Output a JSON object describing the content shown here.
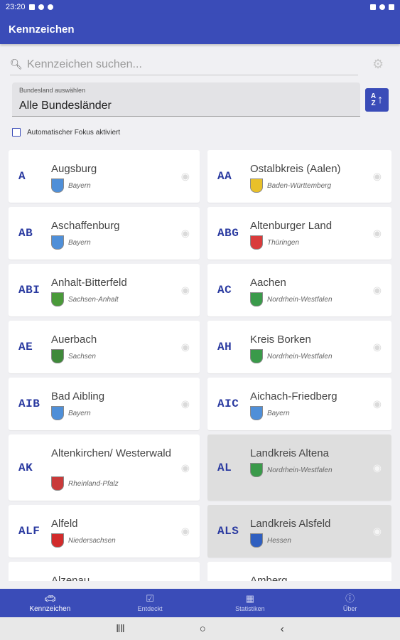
{
  "status": {
    "time": "23:20"
  },
  "appbar": {
    "title": "Kennzeichen"
  },
  "search": {
    "placeholder": "Kennzeichen suchen..."
  },
  "state_select": {
    "label": "Bundesland auswählen",
    "value": "Alle Bundesländer"
  },
  "sort_button": {
    "a": "A",
    "z": "Z"
  },
  "focus": {
    "label": "Automatischer Fokus aktiviert"
  },
  "plates": [
    {
      "code": "A",
      "name": "Augsburg",
      "state": "Bayern",
      "crest": "#4f8fd8"
    },
    {
      "code": "AA",
      "name": "Ostalbkreis (Aalen)",
      "state": "Baden-Württemberg",
      "crest": "#e8c02a"
    },
    {
      "code": "AB",
      "name": "Aschaffenburg",
      "state": "Bayern",
      "crest": "#4f8fd8"
    },
    {
      "code": "ABG",
      "name": "Altenburger Land",
      "state": "Thüringen",
      "crest": "#d93b3b"
    },
    {
      "code": "ABI",
      "name": "Anhalt-Bitterfeld",
      "state": "Sachsen-Anhalt",
      "crest": "#4a9a3a"
    },
    {
      "code": "AC",
      "name": "Aachen",
      "state": "Nordrhein-Westfalen",
      "crest": "#3a9a4a"
    },
    {
      "code": "AE",
      "name": "Auerbach",
      "state": "Sachsen",
      "crest": "#3f8a3a"
    },
    {
      "code": "AH",
      "name": "Kreis Borken",
      "state": "Nordrhein-Westfalen",
      "crest": "#3a9a4a"
    },
    {
      "code": "AIB",
      "name": "Bad Aibling",
      "state": "Bayern",
      "crest": "#4f8fd8"
    },
    {
      "code": "AIC",
      "name": "Aichach-Friedberg",
      "state": "Bayern",
      "crest": "#4f8fd8"
    },
    {
      "code": "AK",
      "name": "Altenkirchen/ Westerwald",
      "state": "Rheinland-Pfalz",
      "crest": "#c93a3a"
    },
    {
      "code": "AL",
      "name": "Landkreis Altena",
      "state": "Nordrhein-Westfalen",
      "crest": "#3a9a4a"
    },
    {
      "code": "ALF",
      "name": "Alfeld",
      "state": "Niedersachsen",
      "crest": "#d22b2b"
    },
    {
      "code": "ALS",
      "name": "Landkreis Alsfeld",
      "state": "Hessen",
      "crest": "#2f5fc0"
    },
    {
      "code": "",
      "name": "Alzenau",
      "state": "",
      "crest": ""
    },
    {
      "code": "",
      "name": "Amberg",
      "state": "",
      "crest": ""
    }
  ],
  "nav": [
    {
      "label": "Kennzeichen",
      "icon": "car-icon"
    },
    {
      "label": "Entdeckt",
      "icon": "checklist-icon"
    },
    {
      "label": "Statistiken",
      "icon": "chart-icon"
    },
    {
      "label": "Über",
      "icon": "info-icon"
    }
  ]
}
